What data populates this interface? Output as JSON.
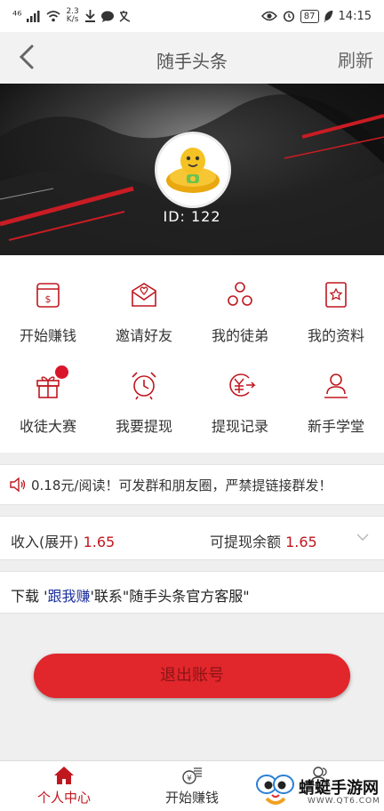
{
  "status_bar": {
    "signal": "⁴⁶",
    "speed_value": "2.3",
    "speed_unit": "K/s",
    "battery": "87",
    "time": "14:15"
  },
  "nav": {
    "title": "随手头条",
    "refresh_label": "刷新"
  },
  "profile": {
    "id_text": "ID:  122"
  },
  "menu": {
    "items": [
      {
        "label": "开始赚钱",
        "icon": "wallet-icon"
      },
      {
        "label": "邀请好友",
        "icon": "invite-envelope-icon"
      },
      {
        "label": "我的徒弟",
        "icon": "disciples-icon"
      },
      {
        "label": "我的资料",
        "icon": "profile-card-icon"
      },
      {
        "label": "收徒大赛",
        "icon": "gift-icon",
        "badge": true
      },
      {
        "label": "我要提现",
        "icon": "alarm-clock-icon"
      },
      {
        "label": "提现记录",
        "icon": "yuan-record-icon"
      },
      {
        "label": "新手学堂",
        "icon": "user-learn-icon"
      }
    ]
  },
  "notice": {
    "text": "0.18元/阅读！可发群和朋友圈，严禁提链接群发！"
  },
  "income": {
    "income_label": "收入(展开)",
    "income_value": "1.65",
    "balance_label": "可提现余额",
    "balance_value": "1.65"
  },
  "download": {
    "prefix": "下载 '",
    "app_name": "跟我赚",
    "suffix": "'联系\"随手头条官方客服\""
  },
  "logout": {
    "label": "退出账号"
  },
  "tabs": [
    {
      "label": "个人中心",
      "active": true
    },
    {
      "label": "开始赚钱",
      "active": false
    }
  ],
  "watermark": {
    "text": "蜻蜓手游网",
    "sub": "WWW.QT6.COM"
  },
  "colors": {
    "accent": "#c0171f",
    "button": "#e1262c",
    "link_blue": "#1b2f9c"
  }
}
